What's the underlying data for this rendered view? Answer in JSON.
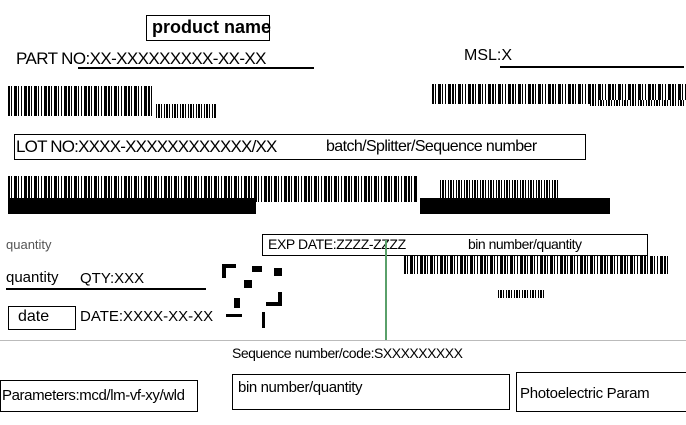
{
  "header": {
    "product_name": "product name",
    "part_no": "PART NO:XX-XXXXXXXXX-XX-XX",
    "msl": "MSL:X"
  },
  "lot": {
    "lot_no": "LOT NO:XXXX-XXXXXXXXXXXX/XX",
    "batch_label": "batch/Splitter/Sequence number"
  },
  "quantity": {
    "left_label": "quantity",
    "label": "quantity",
    "value": "QTY:XXX"
  },
  "expiry": {
    "text": "EXP DATE:ZZZZ-ZZZZ",
    "bin_label": "bin number/quantity"
  },
  "date": {
    "label": "date",
    "value": "DATE:XXXX-XX-XX"
  },
  "sequence": {
    "text": "Sequence number/code:SXXXXXXXXX"
  },
  "parameters": {
    "text": "Parameters:mcd/lm-vf-xy/wld",
    "bin_quantity": "bin number/quantity",
    "photo": "Photoelectric Param"
  },
  "colors": {
    "border": "#000000",
    "divider": "#5aa06a",
    "accent": "#3a5fcd"
  }
}
